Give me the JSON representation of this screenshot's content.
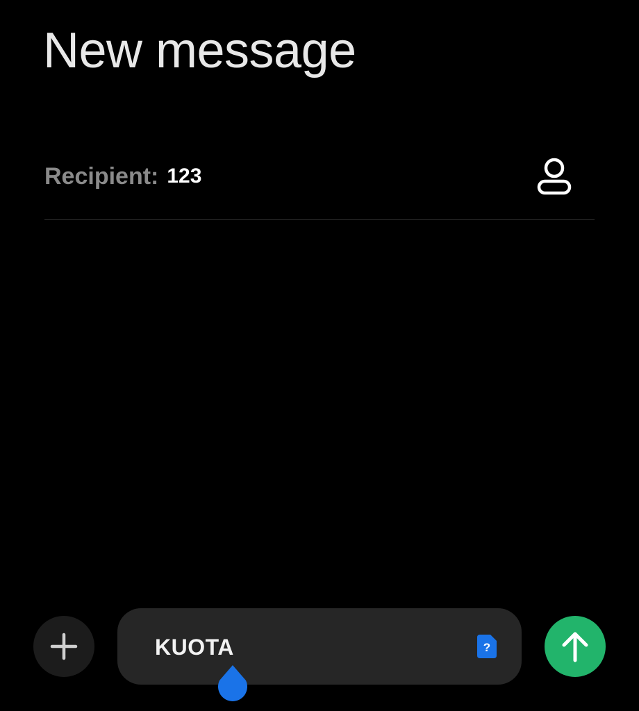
{
  "header": {
    "title": "New message"
  },
  "recipient": {
    "label": "Recipient:",
    "value": "123",
    "contact_icon": "person-icon"
  },
  "composer": {
    "add_icon": "plus-icon",
    "text": "KUOTA",
    "sim_icon": "sim-card-question-icon",
    "sim_label": "?",
    "send_icon": "arrow-up-icon"
  },
  "colors": {
    "background": "#000000",
    "send_button": "#22b46b",
    "accent_blue": "#1a73e8",
    "compose_bg": "#262626"
  }
}
